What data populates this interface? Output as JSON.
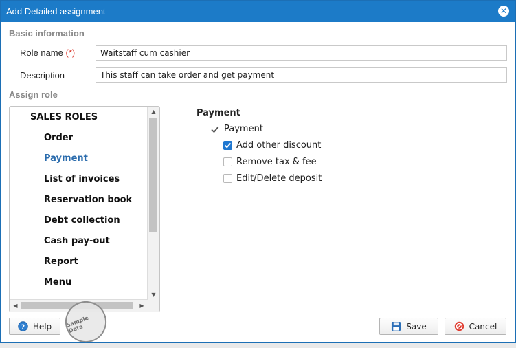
{
  "background": {
    "top_text": ""
  },
  "dialog": {
    "title": "Add Detailed assignment",
    "close_glyph": "✕"
  },
  "basic_info": {
    "section_label": "Basic information",
    "role_name_label": "Role name",
    "required_marker": "(*)",
    "role_name_value": "Waitstaff cum cashier",
    "description_label": "Description",
    "description_value": "This staff can take order and get payment"
  },
  "assign_role": {
    "section_label": "Assign role",
    "tree": {
      "root": "SALES ROLES",
      "items": [
        "Order",
        "Payment",
        "List of invoices",
        "Reservation book",
        "Debt collection",
        "Cash pay-out",
        "Report",
        "Menu"
      ],
      "selected": "Payment"
    }
  },
  "permissions": {
    "heading": "Payment",
    "parent": {
      "label": "Payment",
      "checked": true
    },
    "children": [
      {
        "label": "Add other discount",
        "checked": true
      },
      {
        "label": "Remove tax & fee",
        "checked": false
      },
      {
        "label": "Edit/Delete deposit",
        "checked": false
      }
    ]
  },
  "footer": {
    "help_label": "Help",
    "save_label": "Save",
    "cancel_label": "Cancel",
    "stamp_text": "Sample Data"
  },
  "colors": {
    "titlebar": "#1c7bc8",
    "accent_blue": "#1f77d0",
    "selected_node": "#2b6cad",
    "required": "#d9362b",
    "cancel_icon": "#e03b2f"
  }
}
